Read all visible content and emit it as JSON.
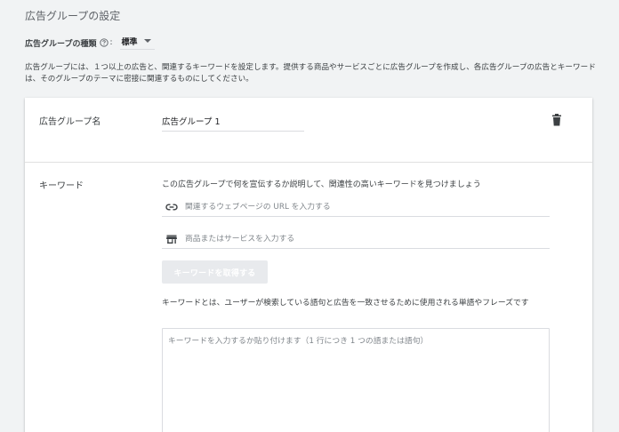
{
  "page": {
    "title": "広告グループの設定",
    "ad_group_type_label": "広告グループの種類",
    "colon": ":",
    "ad_group_type_value": "標準",
    "description": "広告グループには、１つ以上の広告と、関連するキーワードを設定します。提供する商品やサービスごとに広告グループを作成し、各広告グループの広告とキーワードは、そのグループのテーマに密接に関連するものにしてください。"
  },
  "ad_group": {
    "name_label": "広告グループ名",
    "name_value": "広告グループ 1"
  },
  "keywords": {
    "label": "キーワード",
    "intro": "この広告グループで何を宣伝するか説明して、関連性の高いキーワードを見つけましょう",
    "url_placeholder": "関連するウェブページの URL を入力する",
    "product_placeholder": "商品またはサービスを入力する",
    "get_keywords_button": "キーワードを取得する",
    "explanation": "キーワードとは、ユーザーが検索している語句と広告を一致させるために使用される単語やフレーズです",
    "textarea_placeholder": "キーワードを入力するか貼り付けます（1 行につき 1 つの語または語句）"
  },
  "icons": {
    "help": "help-circle-icon",
    "dropdown": "chevron-down-icon",
    "delete": "trash-icon",
    "link": "link-icon",
    "store": "store-icon"
  },
  "colors": {
    "background": "#f1f3f4",
    "card": "#ffffff",
    "disabled_button": "#e8eaed",
    "icon": "#3c4043"
  }
}
